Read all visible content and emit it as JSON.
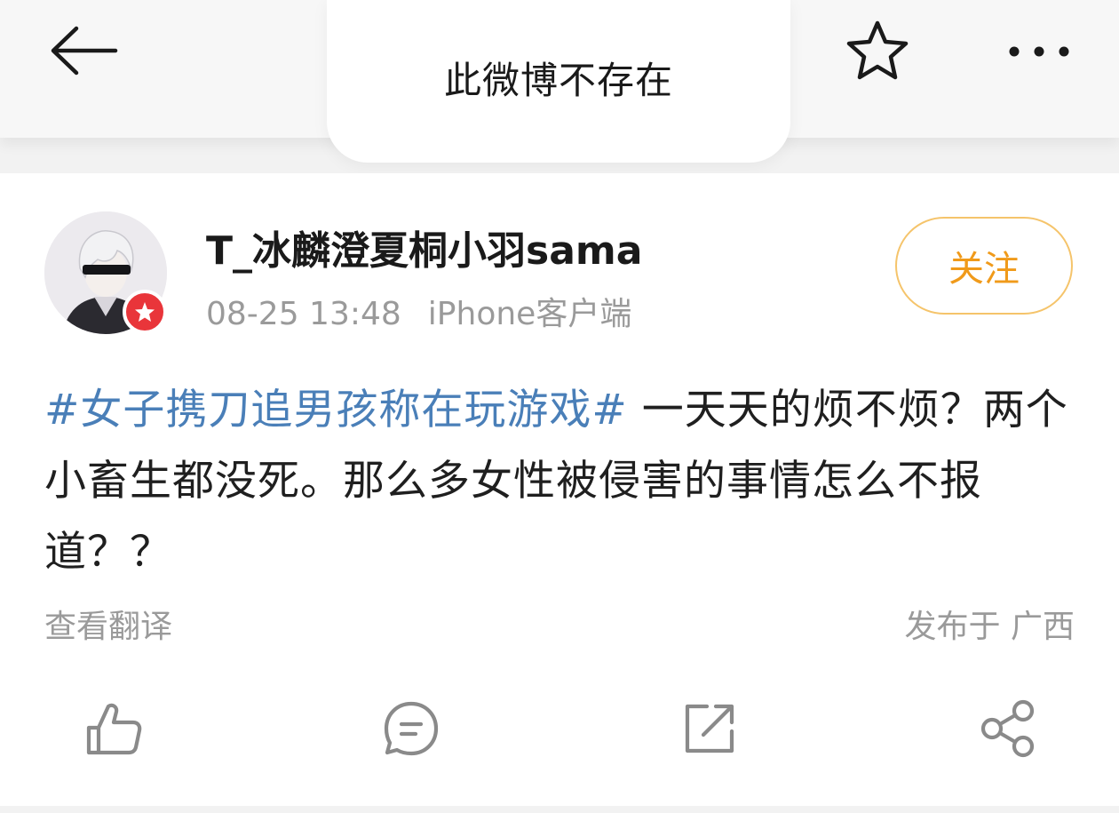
{
  "header": {
    "title": "此微博不存在",
    "back_icon": "back-arrow-icon",
    "favorite_icon": "star-icon",
    "more_icon": "more-dots-icon"
  },
  "post": {
    "username": "T_冰麟澄夏桐小羽sama",
    "date": "08-25 13:48",
    "source": "iPhone客户端",
    "follow_label": "关注",
    "hashtag": "#女子携刀追男孩称在玩游戏#",
    "body": " 一天天的烦不烦？两个小畜生都没死。那么多女性被侵害的事情怎么不报道？？",
    "translate_label": "查看翻译",
    "location": "发布于 广西"
  },
  "actions": {
    "like_icon": "thumbs-up-icon",
    "comment_icon": "comment-icon",
    "repost_icon": "repost-icon",
    "share_icon": "share-icon"
  },
  "colors": {
    "hashtag": "#4a7fb8",
    "follow": "#f09a1a",
    "badge": "#e9353a",
    "meta_text": "#9a9a9a"
  }
}
